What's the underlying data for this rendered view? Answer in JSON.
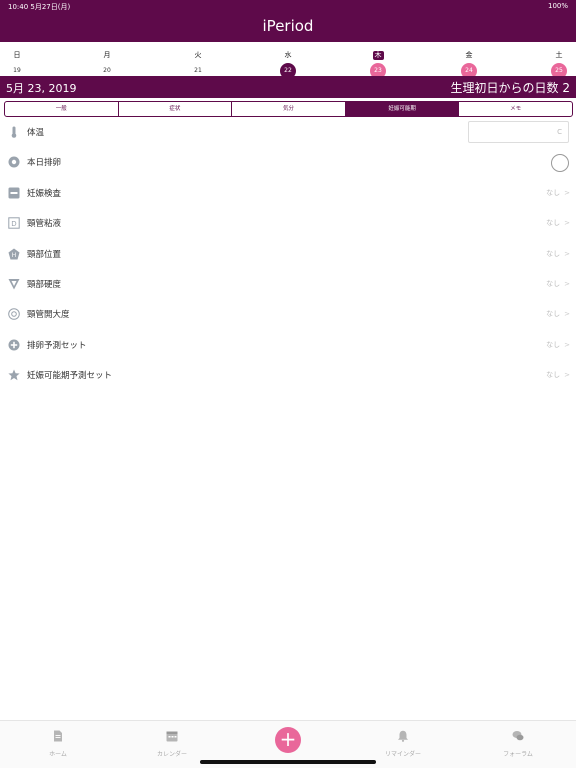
{
  "status": {
    "left": "10:40 5月27日(月)",
    "right": "100%"
  },
  "header": {
    "title": "iPeriod"
  },
  "week": [
    {
      "name": "日",
      "num": "19",
      "style": "plain",
      "name_hl": false
    },
    {
      "name": "月",
      "num": "20",
      "style": "plain",
      "name_hl": false
    },
    {
      "name": "火",
      "num": "21",
      "style": "plain",
      "name_hl": false
    },
    {
      "name": "水",
      "num": "22",
      "style": "dark",
      "name_hl": false
    },
    {
      "name": "木",
      "num": "23",
      "style": "pink",
      "name_hl": true
    },
    {
      "name": "金",
      "num": "24",
      "style": "pink",
      "name_hl": false
    },
    {
      "name": "土",
      "num": "25",
      "style": "pink",
      "name_hl": false
    }
  ],
  "date_bar": {
    "date": "5月 23, 2019",
    "cycle_day": "生理初日からの日数 2"
  },
  "segments": [
    {
      "label": "一般",
      "active": false
    },
    {
      "label": "症状",
      "active": false
    },
    {
      "label": "気分",
      "active": false
    },
    {
      "label": "妊娠可能期",
      "active": true
    },
    {
      "label": "メモ",
      "active": false
    }
  ],
  "rows": [
    {
      "label": "体温",
      "icon": "thermometer-icon",
      "value": "",
      "kind": "input"
    },
    {
      "label": "本日排卵",
      "icon": "ovulation-icon",
      "value": "",
      "kind": "toggle"
    },
    {
      "label": "妊娠検査",
      "icon": "pregnancy-test-icon",
      "value": "なし",
      "kind": "select"
    },
    {
      "label": "頸管粘液",
      "icon": "mucus-icon",
      "value": "なし",
      "kind": "select"
    },
    {
      "label": "頸部位置",
      "icon": "cervix-position-icon",
      "value": "なし",
      "kind": "select"
    },
    {
      "label": "頸部硬度",
      "icon": "cervix-firmness-icon",
      "value": "なし",
      "kind": "select"
    },
    {
      "label": "頸管開大度",
      "icon": "cervix-opening-icon",
      "value": "なし",
      "kind": "select"
    },
    {
      "label": "排卵予測セット",
      "icon": "plus-circle-icon",
      "value": "なし",
      "kind": "select"
    },
    {
      "label": "妊娠可能期予測セット",
      "icon": "star-icon",
      "value": "なし",
      "kind": "select"
    }
  ],
  "temp_unit": "C",
  "chevron": ">",
  "tabbar": {
    "home": "ホーム",
    "calendar": "カレンダー",
    "add": "+",
    "reminder": "リマインダー",
    "forum": "フォーラム"
  },
  "colors": {
    "brand": "#5e0a4a",
    "accent": "#e9679a"
  }
}
